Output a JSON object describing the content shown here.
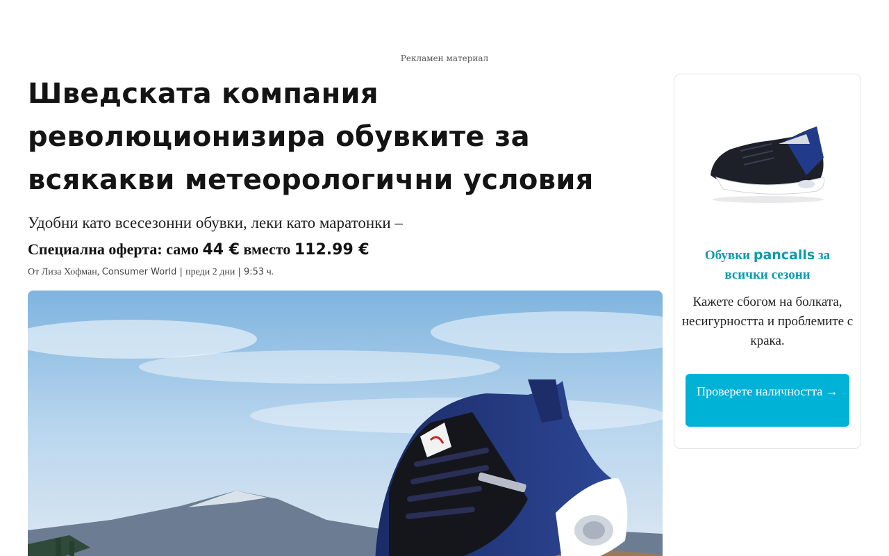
{
  "ad_label": "Рекламен материал",
  "article": {
    "headline": "Шведската компания революционизира обувките за всякакви метеорологични условия",
    "subhead": "Удобни като всесезонни обувки, леки като маратонки –",
    "offer": {
      "prefix": "Специална оферта: само ",
      "price": "44 €",
      "middle": " вместо ",
      "old_price": "112.99 €"
    },
    "byline": {
      "author": "От Лиза Хофман, ",
      "publication": "Consumer World",
      "sep1": " | ",
      "date": "преди 2 дни",
      "sep2": " | ",
      "time": "9:53",
      "time_suffix": " ч."
    },
    "hero_image": "sneaker-on-rock-mountain-photo"
  },
  "sidebar": {
    "title_prefix": "Обувки ",
    "brand": "pancalls",
    "title_suffix": " за всички сезони",
    "text": "Кажете сбогом на болката, несигурността и проблемите с крака.",
    "cta": "Проверете наличността →",
    "product_image": "black-blue-sneaker-icon"
  },
  "colors": {
    "accent": "#0e9aad",
    "button": "#00b3d6",
    "headline": "#141414"
  }
}
